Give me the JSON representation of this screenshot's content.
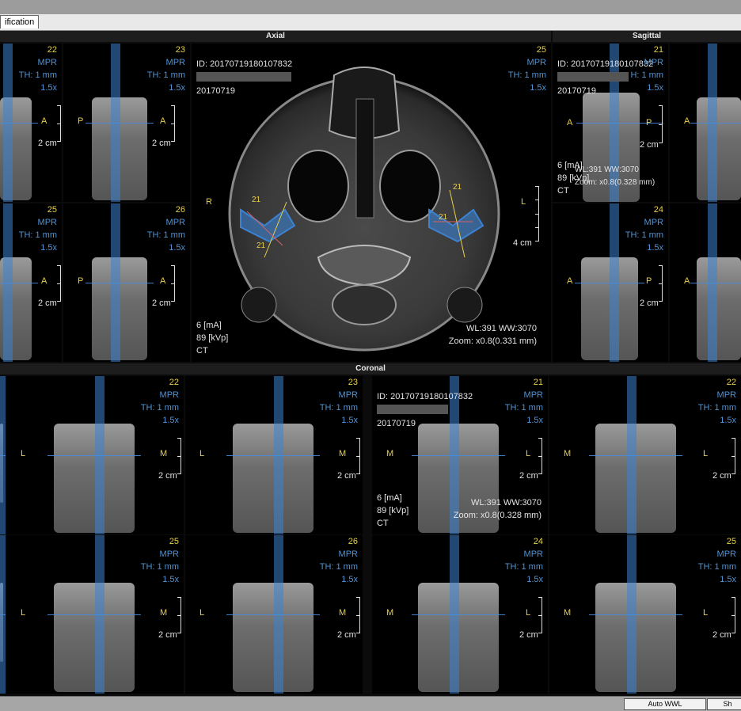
{
  "tab": {
    "label": "ification"
  },
  "headers": {
    "axial": "Axial",
    "sagittal": "Sagittal",
    "coronal": "Coronal"
  },
  "common": {
    "mpr": "MPR",
    "th": "TH: 1 mm",
    "zoom": "1.5x",
    "scale": "2 cm"
  },
  "left_cells": [
    {
      "num": "22",
      "dir_left": "",
      "dir_right": "A"
    },
    {
      "num": "23",
      "dir_left": "P",
      "dir_right": "A"
    },
    {
      "num": "25",
      "dir_left": "",
      "dir_right": "A"
    },
    {
      "num": "26",
      "dir_left": "P",
      "dir_right": "A"
    }
  ],
  "axial": {
    "id": "ID: 20170719180107832",
    "date": "20170719",
    "num": "25",
    "mpr": "MPR",
    "th": "TH: 1 mm",
    "zoom": "1.5x",
    "dir_left": "R",
    "dir_right": "L",
    "scale": "4 cm",
    "ma": "6 [mA]",
    "kvp": "89 [kVp]",
    "modality": "CT",
    "wlww": "WL:391 WW:3070",
    "zoominfo": "Zoom: x0.8(0.331 mm)",
    "markers": [
      "21",
      "21",
      "21",
      "21"
    ]
  },
  "sagittal_top": {
    "id": "ID: 20170719180107832",
    "date": "20170719",
    "num": "21",
    "th": "H: 1 mm",
    "zoom": "1.5x",
    "dir_left": "A",
    "dir_right": "P",
    "scale": "2 cm",
    "ma": "6 [mA]",
    "kvp": "89 [kVp]",
    "modality": "CT",
    "wlww": "WL:391 WW:3070",
    "zoominfo": "Zoom: x0.8(0.328 mm)"
  },
  "sagittal_cells": [
    {
      "num": "24",
      "dir_left": "A",
      "dir_right": "P"
    }
  ],
  "sagittal_right_cells": [
    {
      "dir_left": "A"
    },
    {
      "dir_left": "A"
    }
  ],
  "coronal_cells": [
    {
      "num": "22",
      "dir_left": "L",
      "dir_right": "M"
    },
    {
      "num": "23",
      "dir_left": "L",
      "dir_right": "M"
    },
    {
      "num": "21",
      "dir_left": "M",
      "dir_right": "L"
    },
    {
      "num": "22",
      "dir_left": "M",
      "dir_right": "L"
    },
    {
      "num": "25",
      "dir_left": "L",
      "dir_right": "M"
    },
    {
      "num": "26",
      "dir_left": "L",
      "dir_right": "M"
    },
    {
      "num": "24",
      "dir_left": "M",
      "dir_right": "L"
    },
    {
      "num": "25",
      "dir_left": "M",
      "dir_right": "L"
    }
  ],
  "coronal_info": {
    "id": "ID: 20170719180107832",
    "date": "20170719",
    "ma": "6 [mA]",
    "kvp": "89 [kVp]",
    "modality": "CT",
    "wlww": "WL:391 WW:3070",
    "zoominfo": "Zoom: x0.8(0.328 mm)"
  },
  "status": {
    "auto_wwl": "Auto WWL",
    "sh": "Sh"
  },
  "colors": {
    "overlay_number": "#e8d04b",
    "overlay_info": "#4f93d6",
    "plane_line": "#3c82d2"
  }
}
